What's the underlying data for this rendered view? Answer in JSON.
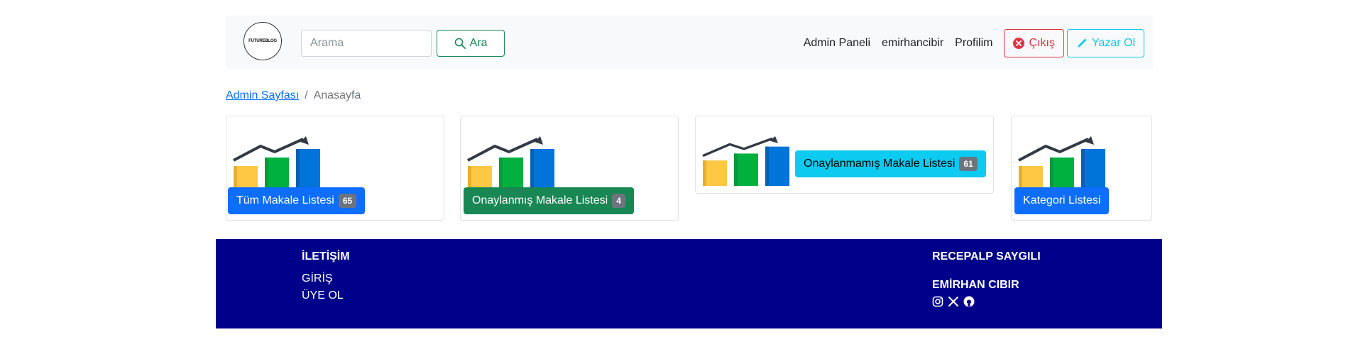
{
  "header": {
    "logo_text": "FUTUREBLOG",
    "search_placeholder": "Arama",
    "search_button": "Ara",
    "nav": {
      "admin_panel": "Admin Paneli",
      "username": "emirhancibir",
      "profile": "Profilim",
      "logout": "Çıkış",
      "become_writer": "Yazar Ol"
    }
  },
  "breadcrumb": {
    "parent": "Admin Sayfası",
    "separator": "/",
    "current": "Anasayfa"
  },
  "cards": [
    {
      "label": "Tüm Makale Listesi",
      "count": "65",
      "color": "#0d6efd"
    },
    {
      "label": "Onaylanmış Makale Listesi",
      "count": "4",
      "color": "#198754"
    },
    {
      "label": "Onaylanmamış Makale Listesi",
      "count": "61",
      "color": "#0dcaf0"
    },
    {
      "label": "Kategori Listesi",
      "color": "#0d6efd"
    }
  ],
  "footer": {
    "contact_title": "İLETİŞİM",
    "login": "GİRİŞ",
    "signup": "ÜYE OL",
    "author1": "RECEPALP SAYGILI",
    "author2": "EMİRHAN CIBIR",
    "social_icons": [
      "instagram-icon",
      "x-icon",
      "github-icon"
    ]
  }
}
